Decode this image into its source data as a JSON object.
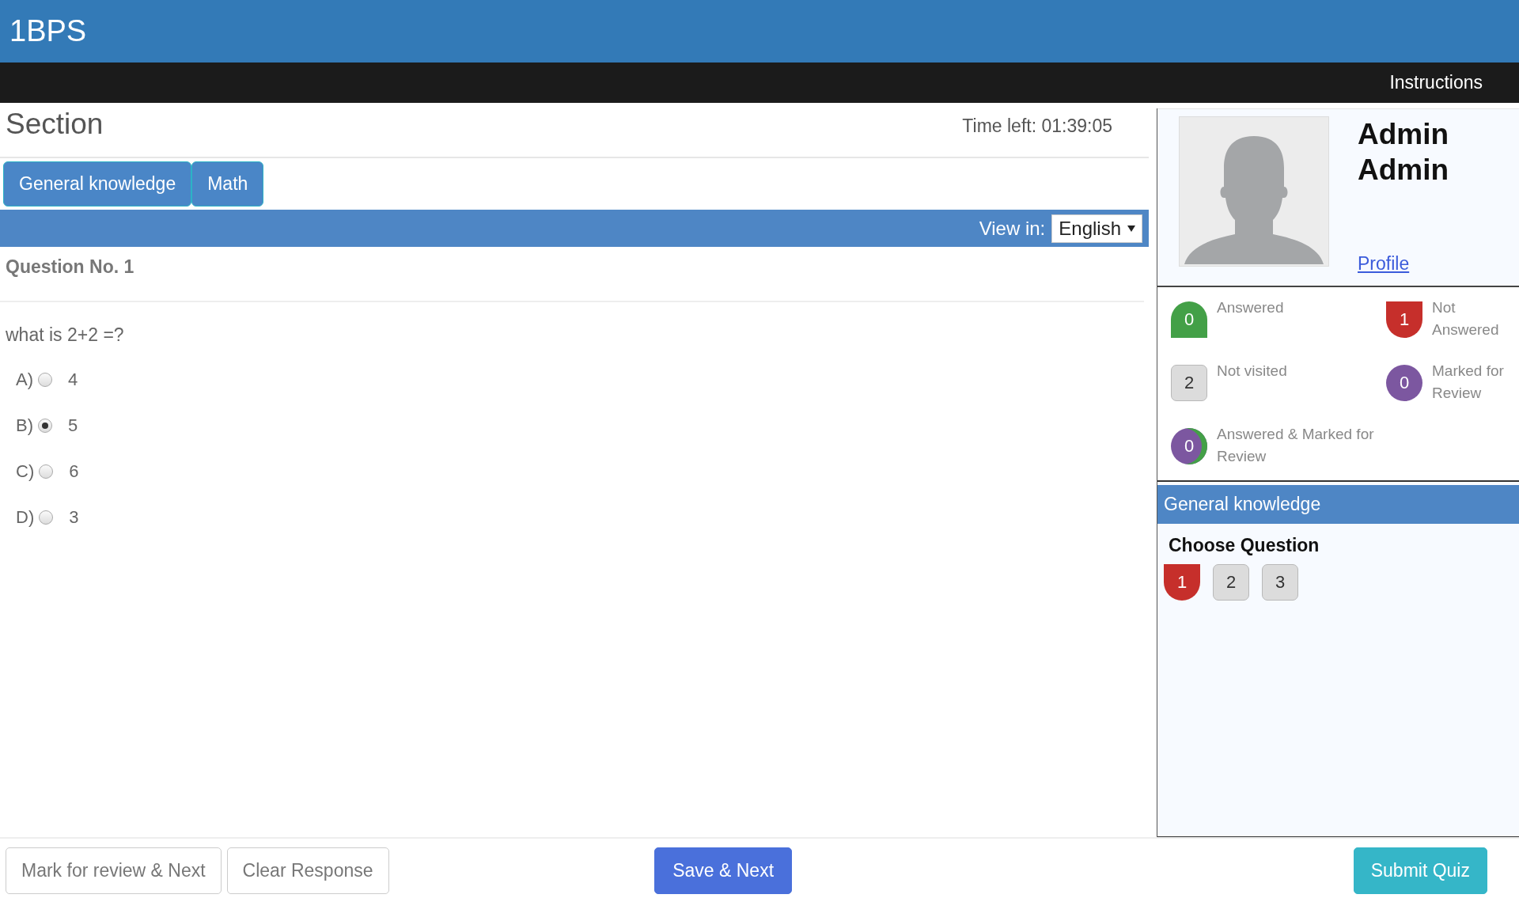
{
  "header": {
    "title": "1BPS"
  },
  "nav": {
    "link": "Instructions"
  },
  "section": {
    "title": "Section",
    "timer": "Time left: 01:39:05"
  },
  "tabs": [
    {
      "label": "General knowledge"
    },
    {
      "label": "Math"
    }
  ],
  "language": {
    "label": "View in:",
    "value": "English"
  },
  "question": {
    "number": "Question No. 1",
    "text": "what is 2+2 =?",
    "options": [
      {
        "letter": "A)",
        "text": "4",
        "selected": false
      },
      {
        "letter": "B)",
        "text": "5",
        "selected": true
      },
      {
        "letter": "C)",
        "text": "6",
        "selected": false
      },
      {
        "letter": "D)",
        "text": "3",
        "selected": false
      }
    ]
  },
  "profile": {
    "name": "Admin Admin",
    "link": "Profile"
  },
  "legend": [
    {
      "kind": "answered",
      "count": "0",
      "label": "Answered"
    },
    {
      "kind": "not_answered",
      "count": "1",
      "label": "Not Answered"
    },
    {
      "kind": "not_visited",
      "count": "2",
      "label": "Not visited"
    },
    {
      "kind": "marked",
      "count": "0",
      "label": "Marked for Review"
    },
    {
      "kind": "answered_marked",
      "count": "0",
      "label": "Answered & Marked for Review"
    }
  ],
  "palette": {
    "section": "General knowledge",
    "heading": "Choose Question",
    "questions": [
      {
        "label": "1",
        "kind": "not_answered"
      },
      {
        "label": "2",
        "kind": "not_visited"
      },
      {
        "label": "3",
        "kind": "not_visited"
      }
    ]
  },
  "actions": [
    {
      "kind": "plain",
      "label": "Mark for review & Next"
    },
    {
      "kind": "plain",
      "label": "Clear Response"
    },
    {
      "kind": "primary",
      "label": "Save & Next"
    },
    {
      "kind": "submit",
      "label": "Submit Quiz"
    }
  ]
}
